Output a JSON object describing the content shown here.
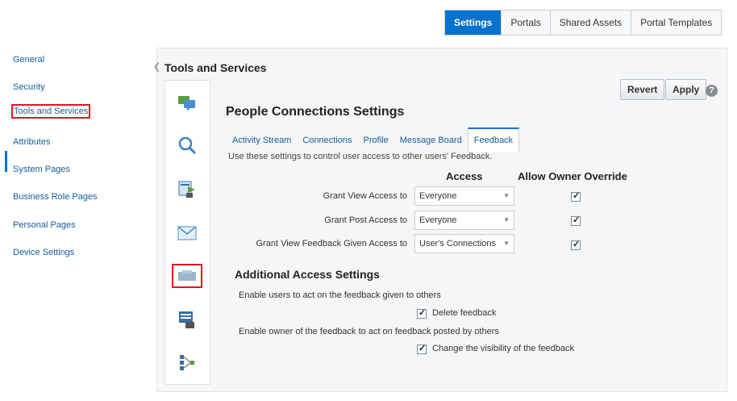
{
  "topnav": {
    "tabs": [
      {
        "label": "Settings",
        "active": true
      },
      {
        "label": "Portals",
        "active": false
      },
      {
        "label": "Shared Assets",
        "active": false
      },
      {
        "label": "Portal Templates",
        "active": false
      }
    ]
  },
  "leftnav": {
    "items": [
      {
        "label": "General"
      },
      {
        "label": "Security"
      },
      {
        "label": "Tools and Services",
        "selected": true
      },
      {
        "label": "Attributes"
      },
      {
        "label": "System Pages"
      },
      {
        "label": "Business Role Pages"
      },
      {
        "label": "Personal Pages"
      },
      {
        "label": "Device Settings"
      }
    ]
  },
  "panel": {
    "title": "Tools and Services",
    "revert_label": "Revert",
    "apply_label": "Apply",
    "help_label": "?",
    "section_title": "People Connections Settings",
    "subtabs": [
      {
        "label": "Activity Stream"
      },
      {
        "label": "Connections"
      },
      {
        "label": "Profile"
      },
      {
        "label": "Message Board"
      },
      {
        "label": "Feedback",
        "active": true
      }
    ],
    "description": "Use these settings to control user access to other users' Feedback.",
    "col_access": "Access",
    "col_override": "Allow Owner Override",
    "rows": [
      {
        "label": "Grant View Access to",
        "value": "Everyone",
        "override": true
      },
      {
        "label": "Grant Post Access to",
        "value": "Everyone",
        "override": true
      },
      {
        "label": "Grant View Feedback Given Access to",
        "value": "User's Connections",
        "override": true
      }
    ],
    "additional_title": "Additional Access Settings",
    "additional": [
      {
        "text": "Enable users to act on the feedback given to others",
        "checkbox_label": "Delete feedback",
        "checked": true
      },
      {
        "text": "Enable owner of the feedback to act on feedback posted by others",
        "checkbox_label": "Change the visibility of the feedback",
        "checked": true
      }
    ]
  },
  "icons": [
    "chat-icon",
    "search-icon",
    "document-transfer-icon",
    "mail-icon",
    "feedback-icon",
    "list-icon",
    "connections-icon"
  ],
  "colors": {
    "accent": "#0572ce",
    "highlight": "#e0161b",
    "link": "#145c9e"
  }
}
